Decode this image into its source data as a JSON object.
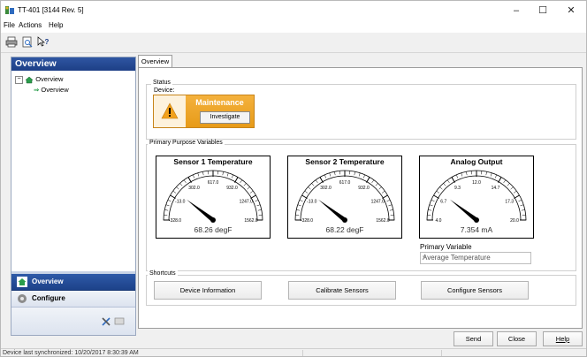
{
  "window": {
    "title": "TT-401 [3144 Rev. 5]"
  },
  "menu": [
    "File",
    "Actions",
    "Help"
  ],
  "left_pane": {
    "header": "Overview",
    "tree": {
      "root": "Overview",
      "child": "Overview"
    },
    "nav": {
      "overview": "Overview",
      "configure": "Configure"
    }
  },
  "tab": "Overview",
  "status_group": {
    "label": "Status",
    "device_label": "Device:",
    "state": "Maintenance",
    "investigate": "Investigate"
  },
  "ppv_group": {
    "label": "Primary Purpose Variables",
    "gauges": [
      {
        "title": "Sensor 1 Temperature",
        "ticks": [
          "-328.0",
          "-13.0",
          "302.0",
          "617.0",
          "932.0",
          "1247.0",
          "1562.0"
        ],
        "min": -328.0,
        "max": 1562.0,
        "value": 68.26,
        "reading": "68.26 degF"
      },
      {
        "title": "Sensor 2 Temperature",
        "ticks": [
          "-328.0",
          "-13.0",
          "302.0",
          "617.0",
          "932.0",
          "1247.0",
          "1562.0"
        ],
        "min": -328.0,
        "max": 1562.0,
        "value": 68.22,
        "reading": "68.22 degF"
      },
      {
        "title": "Analog Output",
        "ticks": [
          "4.0",
          "6.7",
          "9.3",
          "12.0",
          "14.7",
          "17.3",
          "20.0"
        ],
        "min": 4.0,
        "max": 20.0,
        "value": 7.354,
        "reading": "7.354 mA"
      }
    ],
    "primary_variable_label": "Primary Variable",
    "primary_variable_value": "Average Temperature"
  },
  "shortcuts": {
    "label": "Shortcuts",
    "buttons": [
      "Device Information",
      "Calibrate Sensors",
      "Configure Sensors"
    ]
  },
  "buttons": {
    "send": "Send",
    "close": "Close",
    "help": "Help"
  },
  "statusbar": {
    "text": "Device last synchronized: 10/20/2017 8:30:39 AM"
  },
  "colors": {
    "nav_blue": "#2f56a2",
    "maintenance": "#e79b19",
    "needle": "#000000"
  }
}
